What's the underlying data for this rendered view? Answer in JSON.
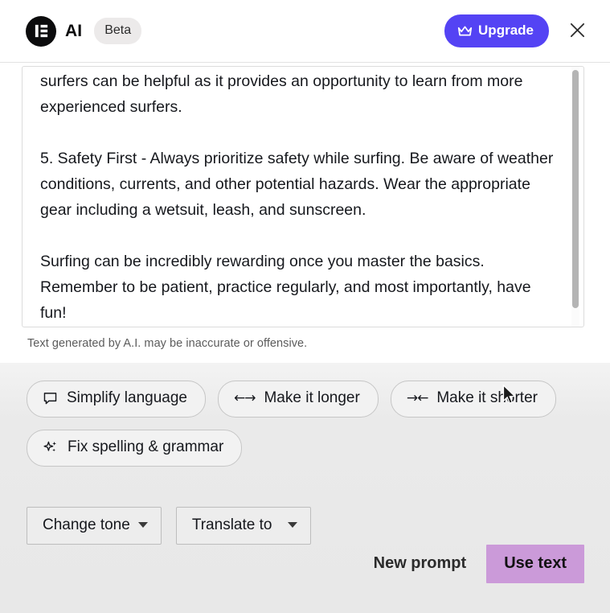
{
  "header": {
    "logo_icon": "elementor-logo-icon",
    "brand_name": "AI",
    "beta_label": "Beta",
    "upgrade_label": "Upgrade",
    "upgrade_icon": "crown-icon",
    "close_icon": "close-icon",
    "accent_color": "#5443f4"
  },
  "result": {
    "paragraphs": [
      "surfers can be helpful as it provides an opportunity to learn from more experienced surfers.",
      "5. Safety First - Always prioritize safety while surfing. Be aware of weather conditions, currents, and other potential hazards. Wear the appropriate gear including a wetsuit, leash, and sunscreen.",
      "Surfing can be incredibly rewarding once you master the basics. Remember to be patient, practice regularly, and most importantly, have fun!"
    ],
    "disclaimer": "Text generated by A.I. may be inaccurate or offensive."
  },
  "actions": {
    "chips": [
      {
        "label": "Simplify language",
        "icon": "speech-bubble-icon"
      },
      {
        "label": "Make it longer",
        "icon": "expand-arrows-icon",
        "glyph": "←→"
      },
      {
        "label": "Make it shorter",
        "icon": "collapse-arrows-icon",
        "glyph": "→←"
      },
      {
        "label": "Fix spelling & grammar",
        "icon": "sparkle-icon"
      }
    ],
    "dropdowns": [
      {
        "label": "Change tone"
      },
      {
        "label": "Translate to"
      }
    ]
  },
  "footer": {
    "new_prompt_label": "New prompt",
    "use_text_label": "Use text",
    "use_text_color": "#cb9ad9"
  }
}
